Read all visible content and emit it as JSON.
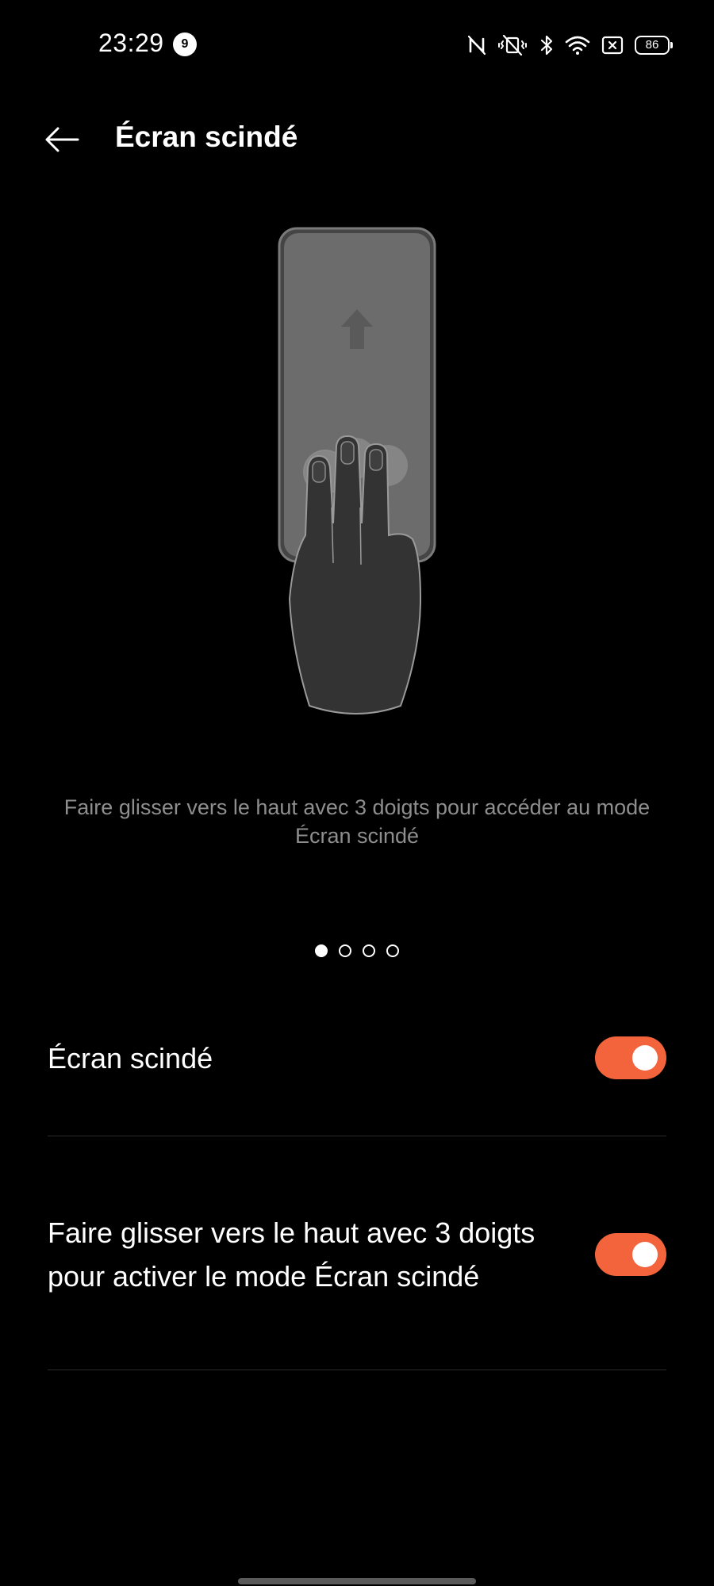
{
  "status_bar": {
    "time": "23:29",
    "notification_count": "9",
    "battery_level": "86",
    "icons": [
      "nfc-icon",
      "vibrate-off-icon",
      "bluetooth-icon",
      "wifi-icon",
      "no-sim-icon",
      "battery-icon"
    ]
  },
  "header": {
    "title": "Écran scindé",
    "back_icon": "arrow-left-icon"
  },
  "illustration": {
    "description": "Faire glisser vers le haut avec 3 doigts pour accéder au mode Écran scindé",
    "page_count": 4,
    "active_page": 1
  },
  "settings": [
    {
      "label": "Écran scindé",
      "enabled": true
    },
    {
      "label": "Faire glisser vers le haut avec 3 doigts pour activer le mode Écran scindé",
      "enabled": true
    }
  ],
  "colors": {
    "accent": "#f4643c",
    "background": "#000000",
    "secondary_text": "#8e8e8e",
    "divider": "#2c2c2c"
  }
}
